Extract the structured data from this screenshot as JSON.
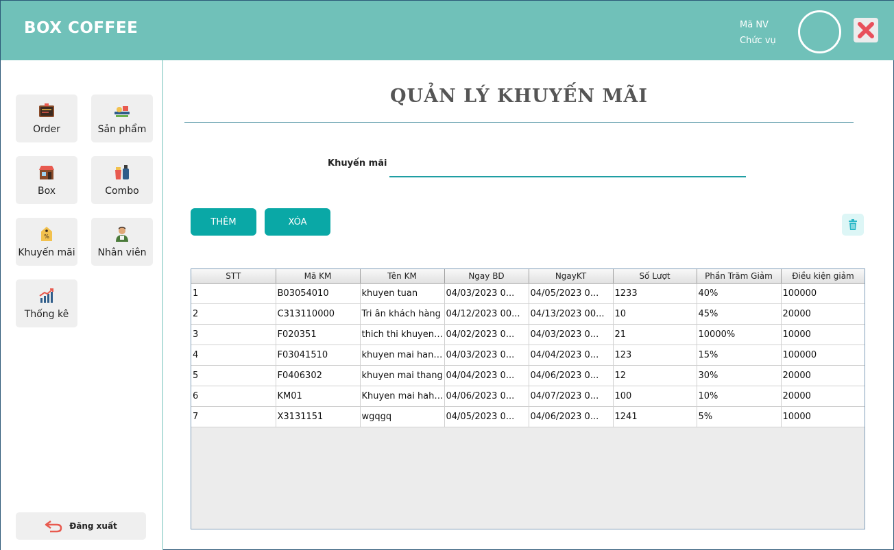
{
  "app": {
    "title": "BOX COFFEE",
    "employee_id_label": "Mã NV",
    "position_label": "Chức vụ"
  },
  "sidebar": {
    "items": [
      {
        "label": "Order",
        "icon": "order-board-icon"
      },
      {
        "label": "Sản phẩm",
        "icon": "food-tray-icon"
      },
      {
        "label": "Box",
        "icon": "shop-icon"
      },
      {
        "label": "Combo",
        "icon": "combo-icon"
      },
      {
        "label": "Khuyến mãi",
        "icon": "discount-tag-icon"
      },
      {
        "label": "Nhân viên",
        "icon": "employee-icon"
      },
      {
        "label": "Thống kê",
        "icon": "statistics-chart-icon"
      }
    ],
    "logout_label": "Đăng xuất"
  },
  "main": {
    "title": "QUẢN LÝ KHUYẾN MÃI",
    "field_label": "Khuyến mãi",
    "field_value": "",
    "add_button": "THÊM",
    "delete_button": "XÓA"
  },
  "table": {
    "columns": [
      "STT",
      "Mã KM",
      "Tên KM",
      "Ngay BD",
      "NgayKT",
      "Số Lượt",
      "Phần Trăm Giảm",
      "Điều kiện giảm"
    ],
    "rows": [
      [
        "1",
        "B03054010",
        "khuyen tuan",
        "04/03/2023 0...",
        "04/05/2023 0...",
        "1233",
        "40%",
        "100000"
      ],
      [
        "2",
        "C313110000",
        "Tri ân khách hàng",
        "04/12/2023 00...",
        "04/13/2023 00...",
        "10",
        "45%",
        "20000"
      ],
      [
        "3",
        "F020351",
        "thich thi khuyen ...",
        "04/02/2023 0...",
        "04/03/2023 0...",
        "21",
        "10000%",
        "10000"
      ],
      [
        "4",
        "F03041510",
        "khuyen mai hang...",
        "04/03/2023 0...",
        "04/04/2023 0...",
        "123",
        "15%",
        "100000"
      ],
      [
        "5",
        "F0406302",
        "khuyen mai thang",
        "04/04/2023 0...",
        "04/06/2023 0...",
        "12",
        "30%",
        "20000"
      ],
      [
        "6",
        "KM01",
        "Khuyen mai haha...",
        "04/06/2023 0...",
        "04/07/2023 0...",
        "100",
        "10%",
        "20000"
      ],
      [
        "7",
        "X3131151",
        "wgqgq",
        "04/05/2023 0...",
        "04/06/2023 0...",
        "1241",
        "5%",
        "10000"
      ]
    ]
  },
  "colors": {
    "header": "#70c1b9",
    "button": "#0aa8a6",
    "close": "#e8505b"
  }
}
